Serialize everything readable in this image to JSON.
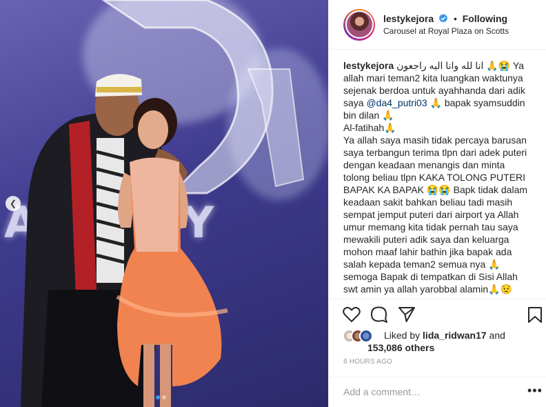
{
  "post": {
    "carousel": {
      "total_slides": 2,
      "active_slide": 1,
      "prev_icon": "chevron-left-icon"
    },
    "photo_stage_text": "ADEMY"
  },
  "header": {
    "username": "lestykejora",
    "verified_icon": "verified-badge-icon",
    "separator": "•",
    "follow_state": "Following",
    "location": "Carousel at Royal Plaza on Scotts"
  },
  "caption": {
    "username": "lestykejora",
    "lines": [
      " انا لله وانا اليه راجعون 🙏😭 Ya",
      "allah mari teman2 kita luangkan waktunya",
      "sejenak berdoa untuk ayahhanda dari adik",
      "saya ",
      " 🙏 bapak syamsuddin",
      "bin dilan 🙏",
      "Al-fatihah🙏",
      "Ya allah saya masih tidak percaya barusan",
      "saya terbangun terima tlpn dari adek puteri",
      "dengan keadaan menangis dan minta",
      "tolong beliau tlpn KAKA TOLONG PUTERI",
      "BAPAK KA BAPAK 😭😭 Bapk tidak dalam",
      "keadaan sakit bahkan beliau tadi masih",
      "sempat jemput puteri dari airport ya Allah",
      "umur memang kita tidak pernah tau saya",
      "mewakili puteri adik saya dan keluarga",
      "mohon maaf lahir bathin jika bapak ada",
      "salah kepada teman2 semua nya 🙏",
      "semoga Bapak di tempatkan di Sisi Allah",
      "swt amin ya allah yarobbal alamin🙏😟"
    ],
    "mention": "@da4_putri03"
  },
  "actions": {
    "like_icon": "heart-icon",
    "comment_icon": "comment-icon",
    "share_icon": "share-icon",
    "save_icon": "bookmark-icon"
  },
  "likes": {
    "prefix": "Liked by ",
    "user": "lida_ridwan17",
    "middle": " and",
    "count": "153,086 others"
  },
  "timestamp": "8 HOURS AGO",
  "comment": {
    "placeholder": "Add a comment…",
    "more_icon": "more-options-icon",
    "more_glyph": "•••"
  },
  "colors": {
    "link": "#003569",
    "accent": "#3897f0",
    "muted": "#999999",
    "divider": "#efefef"
  }
}
